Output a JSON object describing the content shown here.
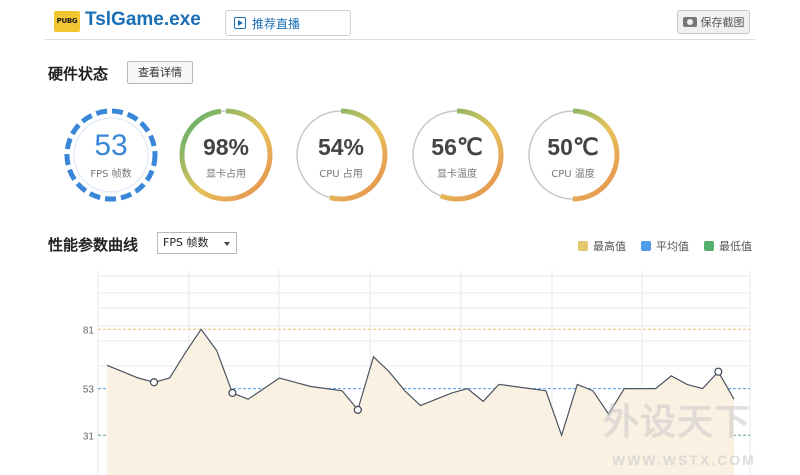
{
  "header": {
    "logo_text": "PUBG",
    "app_title": "TslGame.exe",
    "recommend_live": "推荐直播",
    "save_screenshot": "保存截图"
  },
  "hardware": {
    "title": "硬件状态",
    "detail_button": "查看详情",
    "gauges": [
      {
        "value": "53",
        "label": "FPS 帧数",
        "percent": 100
      },
      {
        "value": "98%",
        "label": "显卡占用",
        "percent": 98
      },
      {
        "value": "54%",
        "label": "CPU 占用",
        "percent": 54
      },
      {
        "value": "56℃",
        "label": "显卡温度",
        "percent": 56
      },
      {
        "value": "50℃",
        "label": "CPU 温度",
        "percent": 50
      }
    ]
  },
  "curve": {
    "title": "性能参数曲线",
    "select_value": "FPS 帧数",
    "legend": [
      {
        "label": "最高值",
        "color": "#e4c66c"
      },
      {
        "label": "平均值",
        "color": "#4f9de8"
      },
      {
        "label": "最低值",
        "color": "#57b06d"
      }
    ]
  },
  "chart_data": {
    "type": "area",
    "y_ticks": [
      31,
      53,
      81
    ],
    "max": 81,
    "avg": 53,
    "min": 31,
    "ylim": [
      0,
      100
    ],
    "values": [
      64,
      61,
      58,
      56,
      58,
      70,
      81,
      71,
      51,
      48,
      53,
      58,
      56,
      54,
      53,
      52,
      43,
      68,
      61,
      52,
      45,
      48,
      51,
      53,
      47,
      55,
      54,
      53,
      52,
      31,
      55,
      52,
      41,
      53,
      53,
      53,
      59,
      55,
      53,
      61,
      48
    ],
    "markers": [
      3,
      8,
      16,
      39
    ],
    "grid": true
  },
  "watermark": {
    "cn": "外设天下",
    "en": "WWW.WSTX.COM"
  },
  "colors": {
    "accent": "#1b6fb5",
    "gauge_gradient_start": "#e58a4f",
    "gauge_gradient_mid": "#e6c35a",
    "gauge_gradient_end": "#4dae6d",
    "fps_ring": "#3a86d8"
  }
}
